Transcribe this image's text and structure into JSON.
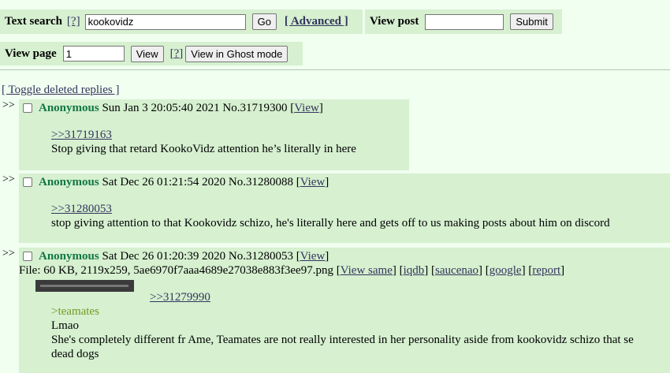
{
  "search": {
    "label": "Text search",
    "help": "[?]",
    "value": "kookovidz",
    "go": "Go",
    "advanced": "[ Advanced ]",
    "view_post_label": "View post",
    "view_post_value": "",
    "submit": "Submit"
  },
  "viewpage": {
    "label": "View page",
    "value": "1",
    "view": "View",
    "help": "[?]",
    "ghost": "View in Ghost mode"
  },
  "toggle": "[ Toggle deleted replies ]",
  "posts": [
    {
      "arrow": ">>",
      "name": "Anonymous",
      "date": "Sun Jan 3 20:05:40 2021",
      "no": "No.31719300",
      "view_open": "[",
      "view": "View",
      "view_close": "]",
      "quote": ">>31719163",
      "lines": [
        "Stop giving that retard KookoVidz attention he’s literally in here"
      ]
    },
    {
      "arrow": ">>",
      "name": "Anonymous",
      "date": "Sat Dec 26 01:21:54 2020",
      "no": "No.31280088",
      "view_open": "[",
      "view": "View",
      "view_close": "]",
      "quote": ">>31280053",
      "lines": [
        "stop giving attention to that Kookovidz schizo, he's literally here and gets off to us making posts about him on discord"
      ]
    },
    {
      "arrow": ">>",
      "name": "Anonymous",
      "date": "Sat Dec 26 01:20:39 2020",
      "no": "No.31280053",
      "view_open": "[",
      "view": "View",
      "view_close": "]",
      "file": {
        "prefix": "File: 60 KB, 2119x259, 5ae6970f7aaa4689e27038e883f3ee97.png [",
        "links": [
          "View same",
          "iqdb",
          "saucenao",
          "google",
          "report"
        ],
        "sep": "] [",
        "suffix": "]"
      },
      "quote": ">>31279990",
      "greentext": ">teamates",
      "lines": [
        "Lmao",
        "She's completely different fr Ame, Teamates are not really interested in her personality aside from kookovidz schizo that se",
        "dead dogs"
      ]
    }
  ]
}
